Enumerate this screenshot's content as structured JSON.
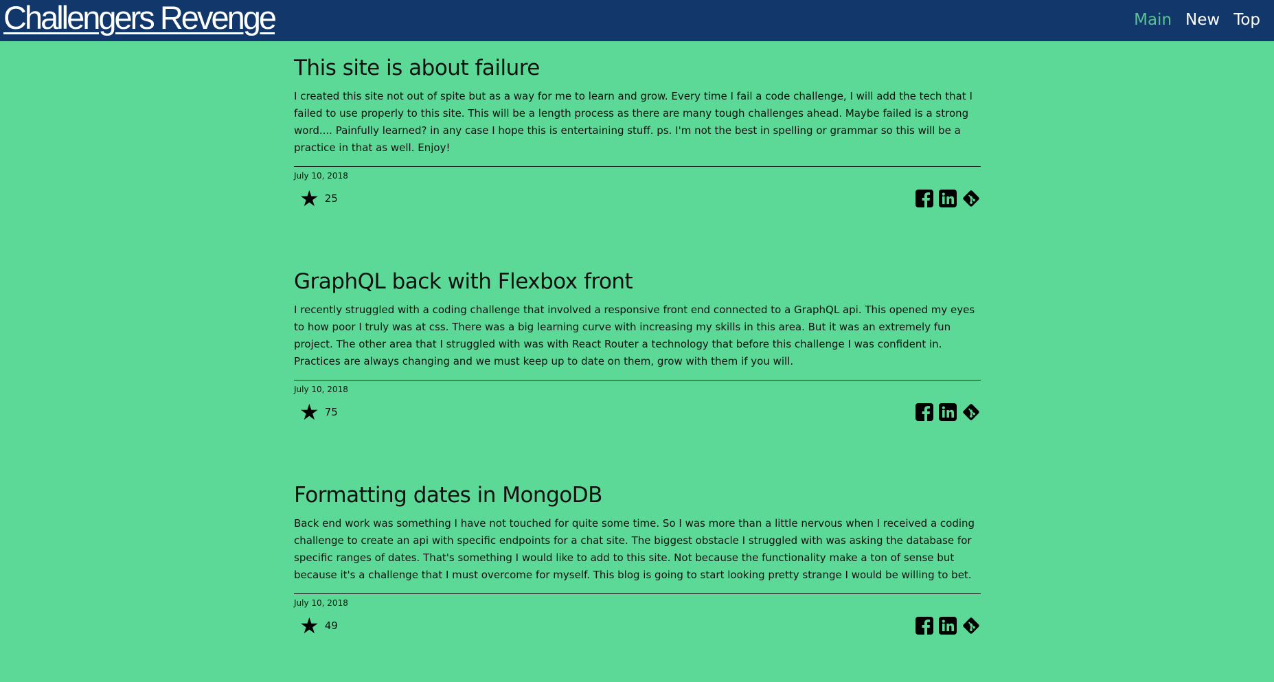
{
  "header": {
    "brand": "Challengers Revenge",
    "nav": [
      {
        "label": "Main",
        "active": true
      },
      {
        "label": "New",
        "active": false
      },
      {
        "label": "Top",
        "active": false
      }
    ]
  },
  "colors": {
    "background": "#5cd996",
    "header": "#12386b",
    "nav_active": "#5cc196"
  },
  "posts": [
    {
      "title": "This site is about failure",
      "body": "I created this site not out of spite but as a way for me to learn and grow. Every time I fail a code challenge, I will add the tech that I failed to use properly to this site. This will be a length process as there are many tough challenges ahead. Maybe failed is a strong word.... Painfully learned? in any case I hope this is entertaining stuff. ps. I'm not the best in spelling or grammar so this will be a practice in that as well. Enjoy!",
      "date": "July 10, 2018",
      "stars": "25"
    },
    {
      "title": "GraphQL back with Flexbox front",
      "body": "I recently struggled with a coding challenge that involved a responsive front end connected to a GraphQL api. This opened my eyes to how poor I truly was at css. There was a big learning curve with increasing my skills in this area. But it was an extremely fun project. The other area that I struggled with was with React Router a technology that before this challenge I was confident in. Practices are always changing and we must keep up to date on them, grow with them if you will.",
      "date": "July 10, 2018",
      "stars": "75"
    },
    {
      "title": "Formatting dates in MongoDB",
      "body": "Back end work was something I have not touched for quite some time. So I was more than a little nervous when I received a coding challenge to create an api with specific endpoints for a chat site. The biggest obstacle I struggled with was asking the database for specific ranges of dates. That's something I would like to add to this site. Not because the functionality make a ton of sense but because it's a challenge that I must overcome for myself. This blog is going to start looking pretty strange I would be willing to bet.",
      "date": "July 10, 2018",
      "stars": "49"
    }
  ],
  "icons": {
    "star": "star-icon",
    "share": [
      "facebook-icon",
      "linkedin-icon",
      "git-icon"
    ]
  }
}
